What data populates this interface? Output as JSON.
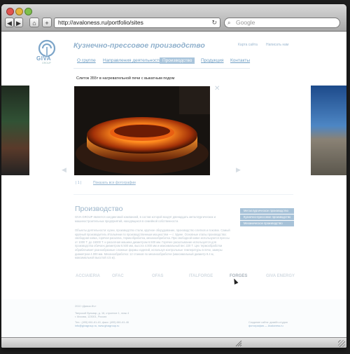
{
  "browser": {
    "url": "http://avaloness.ru/portfolio/sites",
    "search_placeholder": "Google",
    "back_glyph": "◀",
    "forward_glyph": "▶",
    "add_glyph": "+",
    "home_glyph": "⌂",
    "reload_glyph": "↻",
    "search_glyph": "⌕"
  },
  "site": {
    "logo_text": "GIVA",
    "logo_sub": "GROUP",
    "title": "Кузнечно-прессовое производство",
    "header_links": [
      "Карта сайта",
      "Написать нам"
    ],
    "menu": [
      {
        "label": "О группе",
        "active": false
      },
      {
        "label": "Направления деятельности",
        "active": false
      },
      {
        "label": "Производство",
        "active": true
      },
      {
        "label": "Продукция",
        "active": false
      },
      {
        "label": "Контакты",
        "active": false
      }
    ]
  },
  "gallery": {
    "caption": "Слиток 355т в нагревательной печи с выкатным подом",
    "close_glyph": "✕",
    "prev_glyph": "◀",
    "next_glyph": "▶",
    "pager": "| 1 |",
    "all_photos": "Показать все фотографии"
  },
  "section": {
    "title": "Производство",
    "para1": "GIVA GROUP является холдинговой компанией, в состав которой входят двенадцать металлургических и машиностроительных предприятий, находящихся в семейной собственности.",
    "para2": "Объекты деятельности: кузни, производство стали, крупное оборудование, производство слитков и поковок. Самый крупный производитель Итальянии по производственным мощностям — г. Удине. Основные этапы производства: свободная ковка, горячая раскатка, термообработка, механообработка. При свободной ковке используются прессы от 1000 Т. до 15000 Т. и раскатная машина диаметром 6.500 мм. Горячее раскатывание используется для производства обичаек диаметром 6.500 мм, высота 4.000 мм и максимальный вес 220 Т. Цех термообработки обрабатывает разнообразные сложные формы изделий, используя контрольные температуры в печи, замеры диаметром 4.000 мм. Механообработка: 12 станков по механообработке (максимальный диаметр 9.4 м, максимальной высотой 4.5 м).",
    "sidebar": [
      "Металлургическое производство",
      "Кузнечно-прессовое производство",
      "Механическое производство"
    ]
  },
  "partners": [
    "ACCIAIERIA",
    "OFAC",
    "OFAS",
    "ITALFORGE",
    "FORGES",
    "GIVA ENERGY"
  ],
  "footer": {
    "copyright": "2010 «Дивиа Ич»",
    "address1": "Тверской бульвар, д. 16, строение 1, этаж 4",
    "address2": "г. Москва, 123001, Россия",
    "phone": "Тел.: (495) 661-61-40, факс: (495) 661-61-46",
    "emails": "info@givagroup.ru, www.givagroup.ru",
    "dev1": "Создание сайта: дизайн-студия",
    "dev2": "фотография — Avaloness.ru"
  }
}
